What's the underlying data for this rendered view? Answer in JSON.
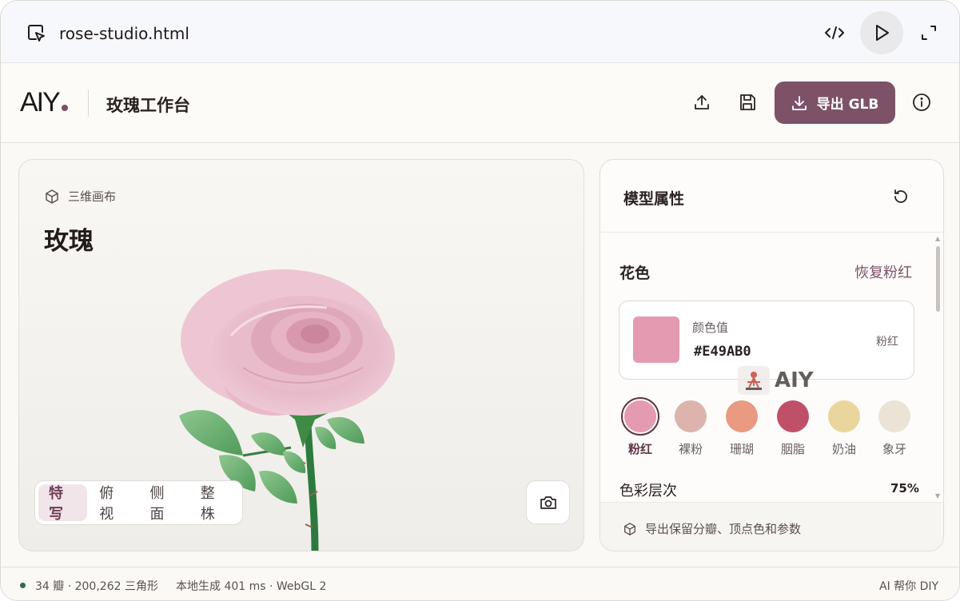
{
  "window": {
    "file_name": "rose-studio.html",
    "icons": [
      "cursor-square-icon",
      "code-icon",
      "play-icon",
      "expand-icon"
    ]
  },
  "header": {
    "logo_text": "AIY",
    "title": "玫瑰工作台",
    "export_label": "导出 GLB",
    "brand_color": "#7d5266"
  },
  "canvas": {
    "label": "三维画布",
    "title": "玫瑰",
    "view_tabs": [
      {
        "label": "特写",
        "active": true
      },
      {
        "label": "俯视",
        "active": false
      },
      {
        "label": "侧面",
        "active": false
      },
      {
        "label": "整株",
        "active": false
      }
    ]
  },
  "panel": {
    "title": "模型属性",
    "section_title": "花色",
    "restore_label": "恢复粉红",
    "color_value_label": "颜色值",
    "color_value": "#E49AB0",
    "color_name": "粉红",
    "watermark_text": "AIY",
    "swatches": [
      {
        "label": "粉红",
        "color": "#e49ab0",
        "selected": true
      },
      {
        "label": "裸粉",
        "color": "#ddb3ad",
        "selected": false
      },
      {
        "label": "珊瑚",
        "color": "#ea9a80",
        "selected": false
      },
      {
        "label": "胭脂",
        "color": "#c04f68",
        "selected": false
      },
      {
        "label": "奶油",
        "color": "#ead69c",
        "selected": false
      },
      {
        "label": "象牙",
        "color": "#ebe3d6",
        "selected": false
      }
    ],
    "layer_label": "色彩层次",
    "layer_value": "75%",
    "footer_text": "导出保留分瓣、顶点色和参数"
  },
  "status": {
    "left": "34 瓣 · 200,262 三角形",
    "mid": "本地生成 401 ms · WebGL 2",
    "right": "AI 帮你 DIY"
  }
}
